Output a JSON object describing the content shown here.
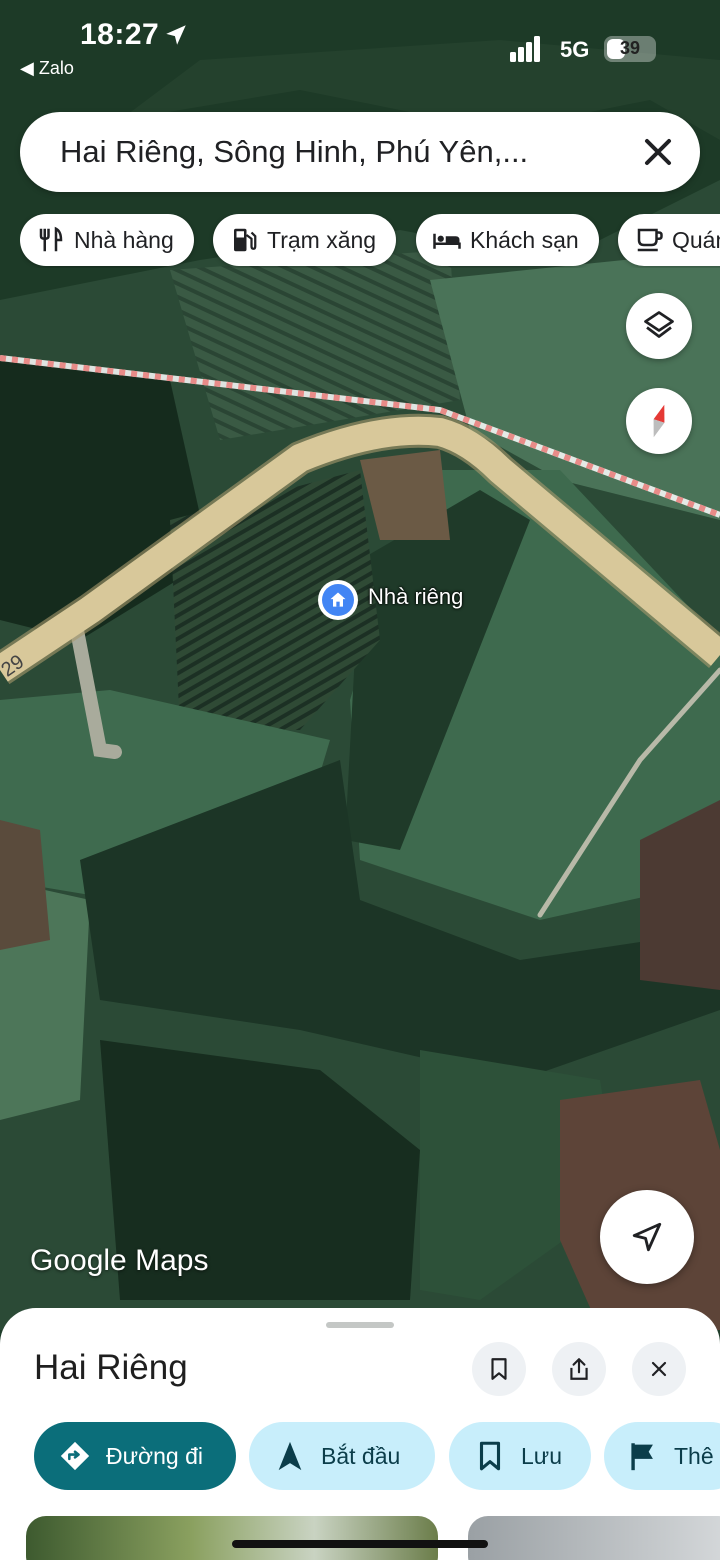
{
  "status_bar": {
    "time": "18:27",
    "back_app": "◀ Zalo",
    "network": "5G",
    "battery": "39",
    "battery_level": 0.39
  },
  "search": {
    "value": "Hai Riêng, Sông Hinh, Phú Yên,..."
  },
  "chips": [
    {
      "label": "Nhà hàng",
      "icon": "restaurant-icon"
    },
    {
      "label": "Trạm xăng",
      "icon": "gas-station-icon"
    },
    {
      "label": "Khách sạn",
      "icon": "hotel-icon"
    },
    {
      "label": "Quán",
      "icon": "cafe-icon"
    }
  ],
  "map": {
    "pin_label": "Nhà riêng",
    "road_number": "29",
    "logo_google": "Google",
    "logo_maps": "Maps"
  },
  "sheet": {
    "title": "Hai Riêng",
    "actions": [
      {
        "label": "Đường đi",
        "icon": "directions-icon"
      },
      {
        "label": "Bắt đầu",
        "icon": "navigation-icon"
      },
      {
        "label": "Lưu",
        "icon": "bookmark-icon"
      },
      {
        "label": "Thê",
        "icon": "flag-icon"
      }
    ]
  },
  "colors": {
    "primary_action": "#0b6e7a",
    "secondary_action": "#c8eefb",
    "road": "#d8c89a"
  }
}
